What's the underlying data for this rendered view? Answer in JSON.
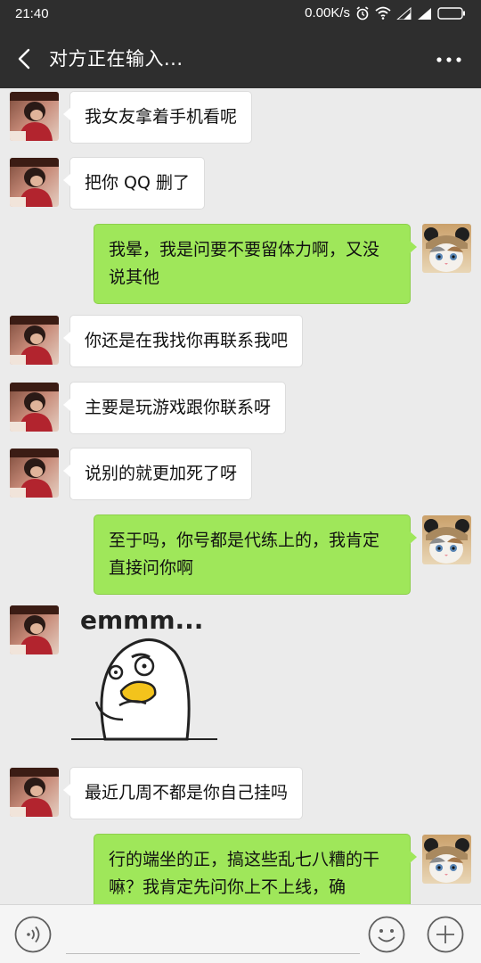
{
  "status_bar": {
    "time": "21:40",
    "network_speed": "0.00K/s"
  },
  "header": {
    "title": "对方正在输入...",
    "back_icon": "chevron-left-icon",
    "more_icon": "more-dots-icon"
  },
  "messages": [
    {
      "side": "left",
      "text": "我女友拿着手机看呢"
    },
    {
      "side": "left",
      "text": "把你 QQ 删了"
    },
    {
      "side": "right",
      "text": "我晕，我是问要不要留体力啊，又没说其他"
    },
    {
      "side": "left",
      "text": "你还是在我找你再联系我吧"
    },
    {
      "side": "left",
      "text": "主要是玩游戏跟你联系呀"
    },
    {
      "side": "left",
      "text": "说别的就更加死了呀"
    },
    {
      "side": "right",
      "text": "至于吗，你号都是代练上的，我肯定直接问你啊"
    },
    {
      "side": "left",
      "type": "sticker",
      "text": "emmm..."
    },
    {
      "side": "left",
      "text": "最近几周不都是你自己挂吗"
    },
    {
      "side": "right",
      "text": "行的端坐的正，搞这些乱七八糟的干嘛？我肯定先问你上不上线，确"
    }
  ],
  "input_bar": {
    "voice_icon": "voice-icon",
    "input_value": "",
    "emoji_icon": "emoji-icon",
    "plus_icon": "plus-icon"
  },
  "colors": {
    "header_bg": "#2e2e2e",
    "chat_bg": "#ebebeb",
    "bubble_self": "#9fe75a",
    "bubble_other": "#ffffff"
  }
}
